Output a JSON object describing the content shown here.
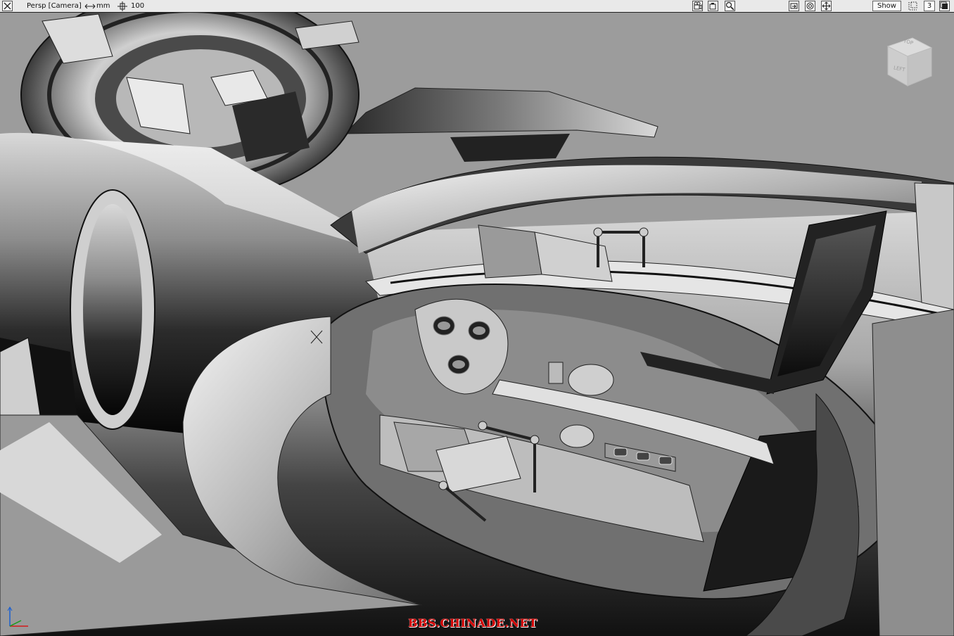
{
  "viewport": {
    "view_label": "Persp [Camera]",
    "unit_label": "mm",
    "grid_value": "100",
    "show_label": "Show",
    "layout_number": "3"
  },
  "viewcube": {
    "top_label": "TOP",
    "left_label": "LEFT"
  },
  "watermark": "BBS.CHINADE.NET",
  "icons": {
    "close": "close-icon",
    "unit": "horizontal-arrows-icon",
    "grid": "grid-snap-icon",
    "camera": "camera-icon",
    "camera2": "video-camera-icon",
    "zoom": "magnify-icon",
    "pan": "pan-icon",
    "orbit": "orbit-icon",
    "move": "move-icon",
    "display": "display-mode-icon",
    "maximize": "maximize-icon"
  },
  "colors": {
    "background": "#9c9c9c",
    "model_light": "#e8e8e8",
    "model_dark": "#1e1e1e",
    "watermark": "#d40000"
  }
}
